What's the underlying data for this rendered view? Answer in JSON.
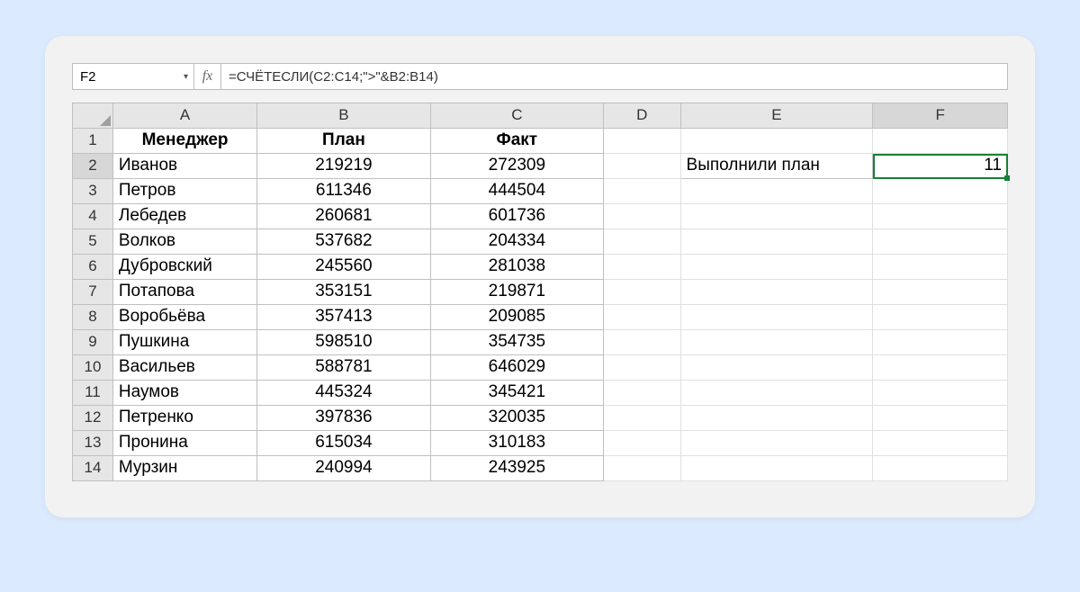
{
  "name_box": "F2",
  "fx_label": "fx",
  "formula": "=СЧЁТЕСЛИ(C2:C14;\">\"&B2:B14)",
  "columns": [
    "A",
    "B",
    "C",
    "D",
    "E",
    "F"
  ],
  "row_numbers": [
    "1",
    "2",
    "3",
    "4",
    "5",
    "6",
    "7",
    "8",
    "9",
    "10",
    "11",
    "12",
    "13",
    "14"
  ],
  "headers": {
    "A": "Менеджер",
    "B": "План",
    "C": "Факт"
  },
  "data_rows": [
    {
      "A": "Иванов",
      "B": "219219",
      "C": "272309"
    },
    {
      "A": "Петров",
      "B": "611346",
      "C": "444504"
    },
    {
      "A": "Лебедев",
      "B": "260681",
      "C": "601736"
    },
    {
      "A": "Волков",
      "B": "537682",
      "C": "204334"
    },
    {
      "A": "Дубровский",
      "B": "245560",
      "C": "281038"
    },
    {
      "A": "Потапова",
      "B": "353151",
      "C": "219871"
    },
    {
      "A": "Воробьёва",
      "B": "357413",
      "C": "209085"
    },
    {
      "A": "Пушкина",
      "B": "598510",
      "C": "354735"
    },
    {
      "A": "Васильев",
      "B": "588781",
      "C": "646029"
    },
    {
      "A": "Наумов",
      "B": "445324",
      "C": "345421"
    },
    {
      "A": "Петренко",
      "B": "397836",
      "C": "320035"
    },
    {
      "A": "Пронина",
      "B": "615034",
      "C": "310183"
    },
    {
      "A": "Мурзин",
      "B": "240994",
      "C": "243925"
    }
  ],
  "summary": {
    "label": "Выполнили план",
    "value": "11"
  },
  "active_cell": "F2"
}
